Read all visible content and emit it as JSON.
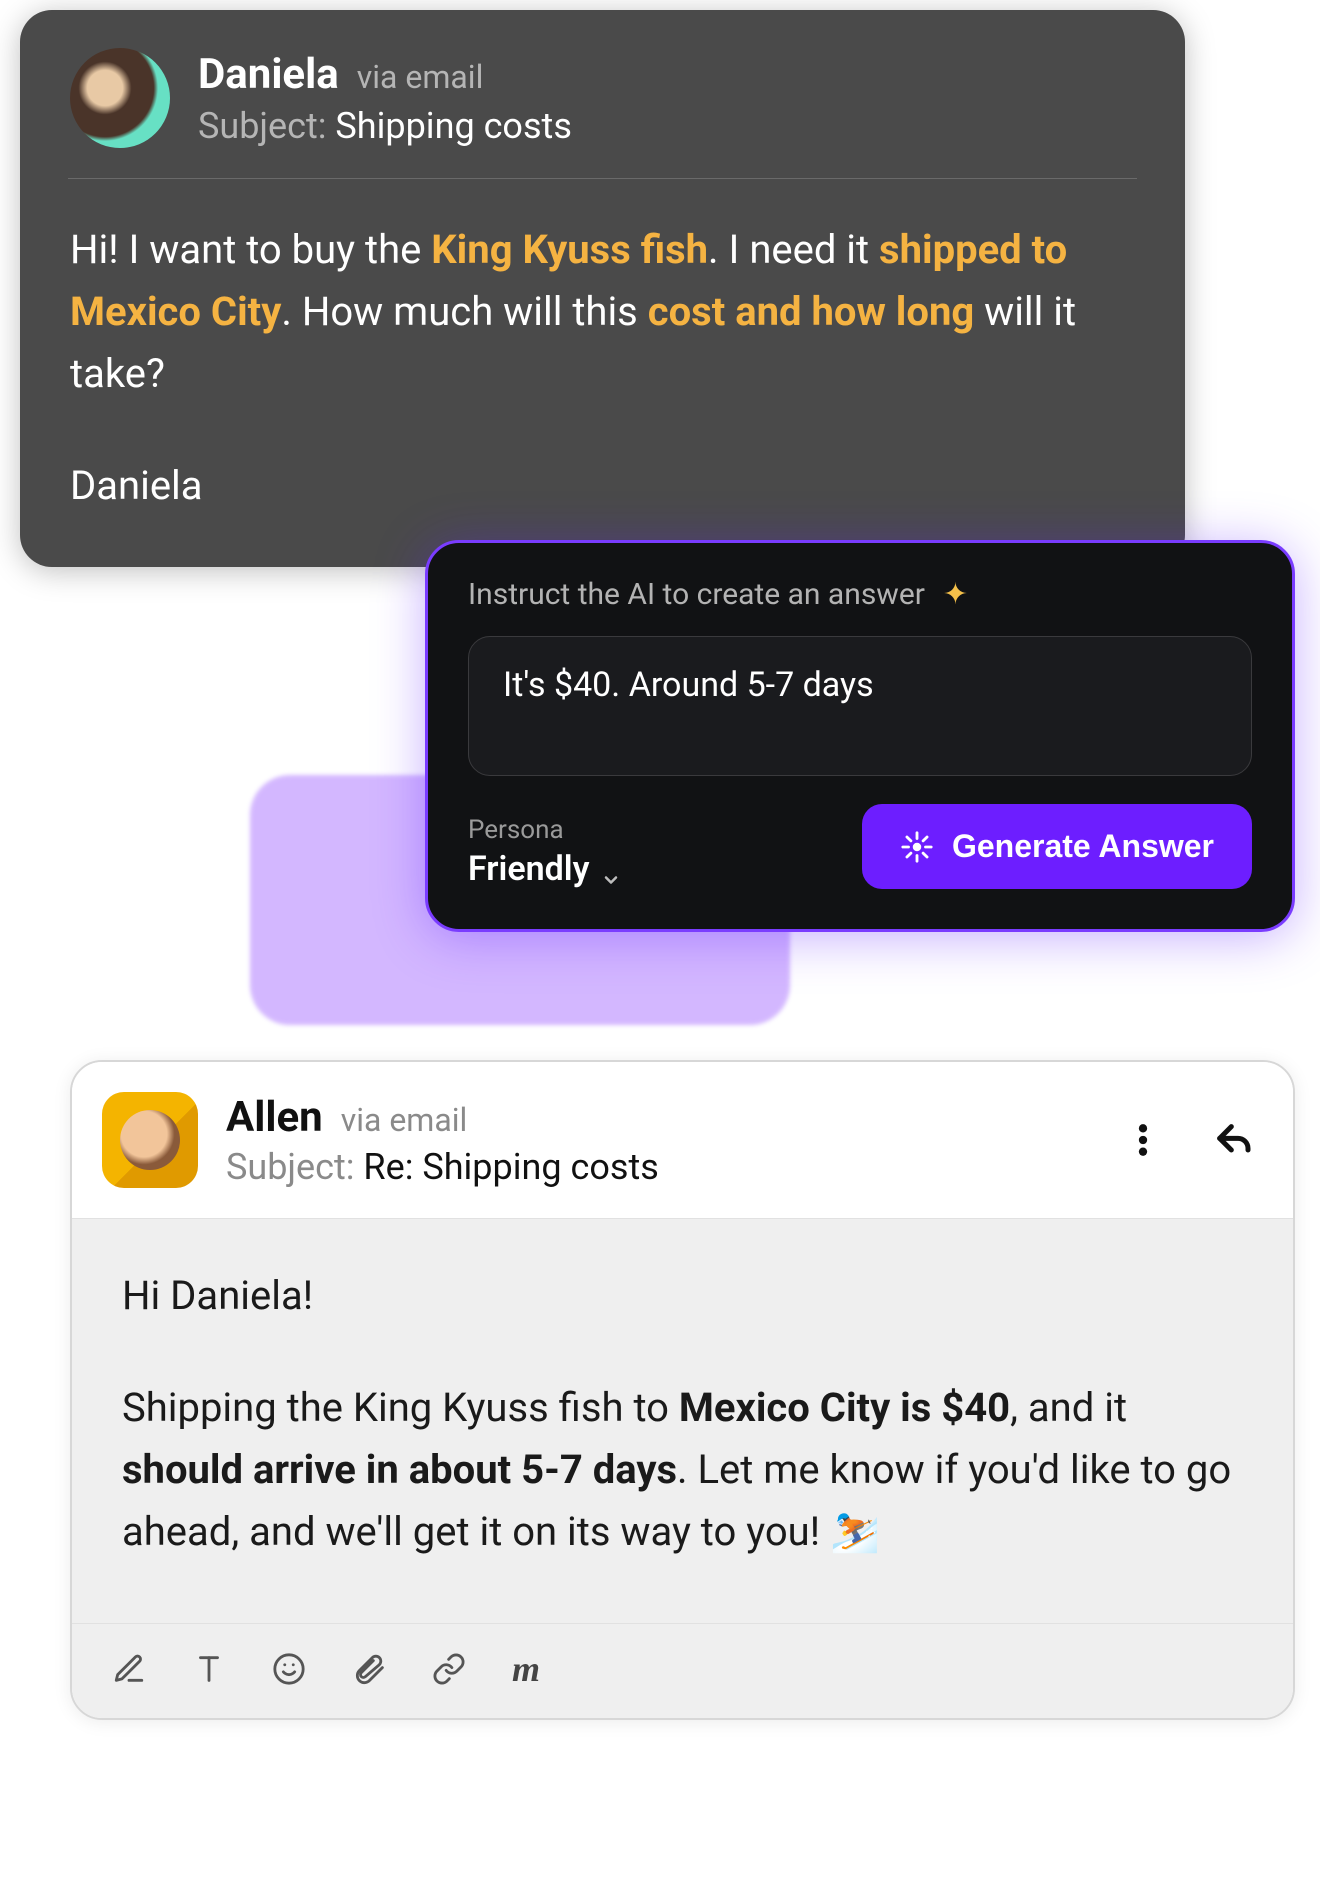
{
  "card1": {
    "sender": "Daniela",
    "via": "via email",
    "subject_label": "Subject:",
    "subject": "Shipping costs",
    "body_pre1": "Hi! I want to buy the ",
    "hl1": "King Kyuss fish",
    "body_mid1": ". I need it ",
    "hl2": "shipped to Mexico City",
    "body_mid2": ". How much will this ",
    "hl3": "cost and how long",
    "body_post": " will it take?",
    "signature": "Daniela"
  },
  "ai": {
    "instruct_label": "Instruct the AI to create an answer",
    "input_value": "It's $40. Around 5-7 days",
    "persona_label": "Persona",
    "persona_value": "Friendly",
    "generate_label": "Generate Answer"
  },
  "card2": {
    "sender": "Allen",
    "via": "via email",
    "subject_label": "Subject:",
    "subject": "Re: Shipping costs",
    "greeting": "Hi Daniela!",
    "p1_a": "Shipping the King Kyuss fish to ",
    "p1_bold1": "Mexico City is $40",
    "p1_b": ", and it ",
    "p1_bold2": "should arrive in about 5-7 days",
    "p1_c": ". Let me know if you'd like to go ahead, and we'll get it on its way to you! ",
    "emoji": "⛷️"
  }
}
